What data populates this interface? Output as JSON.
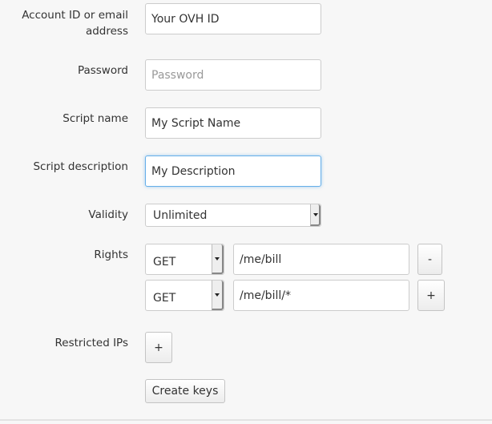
{
  "form": {
    "account": {
      "label": "Account ID or email address",
      "value": "Your OVH ID"
    },
    "password": {
      "label": "Password",
      "placeholder": "Password"
    },
    "script_name": {
      "label": "Script name",
      "value": "My Script Name"
    },
    "script_description": {
      "label": "Script description",
      "value": "My Description"
    },
    "validity": {
      "label": "Validity",
      "value": "Unlimited"
    },
    "rights": {
      "label": "Rights",
      "rows": [
        {
          "method": "GET",
          "path": "/me/bill",
          "button": "-"
        },
        {
          "method": "GET",
          "path": "/me/bill/*",
          "button": "+"
        }
      ]
    },
    "restricted_ips": {
      "label": "Restricted IPs",
      "button": "+"
    },
    "submit": "Create keys"
  },
  "colors": {
    "focus_border": "#66afe9",
    "background": "#f7f7f7"
  }
}
